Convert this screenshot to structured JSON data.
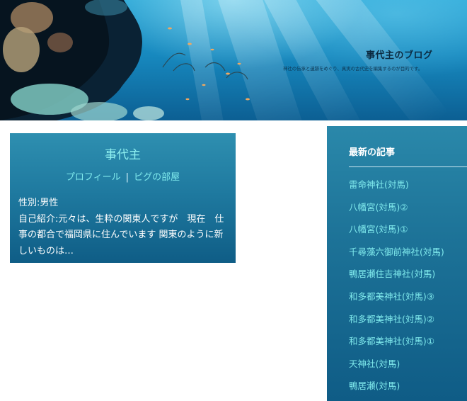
{
  "header": {
    "title": "事代主のブログ",
    "description": "神社の伝承と遺跡をめぐり、真実の古代史を編集するのが目的です。"
  },
  "profile": {
    "name": "事代主",
    "links": [
      "プロフィール",
      "ピグの部屋"
    ],
    "separator": "|",
    "gender": "性別:男性",
    "intro": "自己紹介:元々は、生粋の関東人ですが　現在　仕事の都合で福岡県に住んでいます 関東のように新しいものは…"
  },
  "recent_posts": {
    "title": "最新の記事",
    "items": [
      "雷命神社(対馬)",
      "八幡宮(対馬)②",
      "八幡宮(対馬)①",
      "千尋藻六御前神社(対馬)",
      "鴨居瀬住吉神社(対馬)",
      "和多都美神社(対馬)③",
      "和多都美神社(対馬)②",
      "和多都美神社(対馬)①",
      "天神社(対馬)",
      "鴨居瀬(対馬)"
    ]
  },
  "colors": {
    "link": "#7fe9ec",
    "widget_bg": "#1f7aa0",
    "title_dark": "#0b2a40"
  }
}
